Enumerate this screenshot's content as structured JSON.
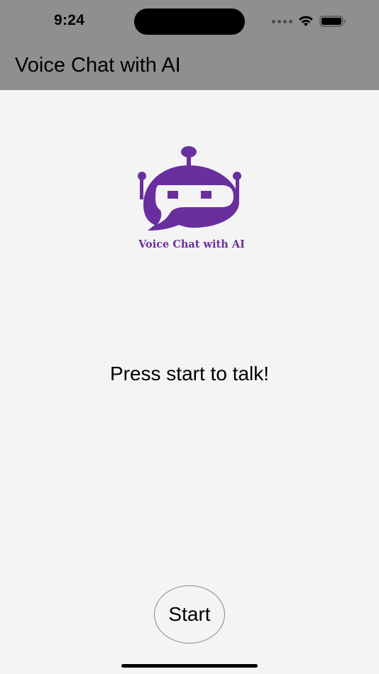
{
  "status_bar": {
    "time": "9:24",
    "icons": [
      "signal-dots-icon",
      "wifi-icon",
      "battery-icon"
    ]
  },
  "header": {
    "title": "Voice Chat with AI"
  },
  "logo": {
    "icon": "robot-chat-icon",
    "caption": "Voice Chat with AI",
    "color": "#6a2f9e"
  },
  "main": {
    "prompt": "Press start to talk!"
  },
  "controls": {
    "start_label": "Start"
  },
  "colors": {
    "header_bg": "#8f8f8f",
    "page_bg": "#f4f4f4",
    "accent": "#6a2f9e"
  }
}
